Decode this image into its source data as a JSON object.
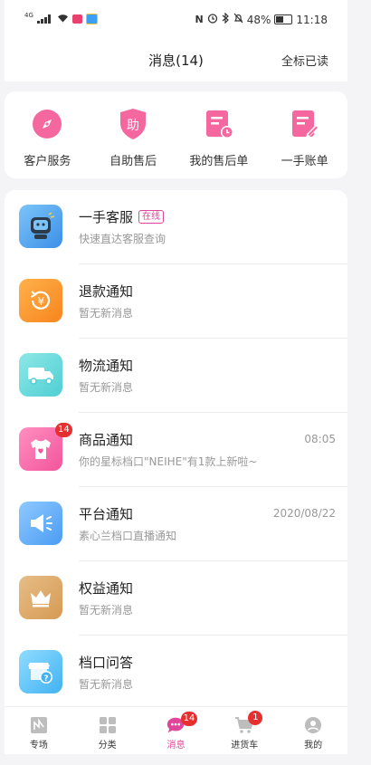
{
  "status_bar": {
    "signal": "4G",
    "battery": "48%",
    "time": "11:18"
  },
  "header": {
    "title": "消息(14)",
    "mark_all_read": "全标已读"
  },
  "quick_entries": [
    {
      "label": "客户服务",
      "icon": "compass-icon"
    },
    {
      "label": "自助售后",
      "icon": "self-service-icon",
      "glyph": "助"
    },
    {
      "label": "我的售后单",
      "icon": "after-sales-order-icon"
    },
    {
      "label": "一手账单",
      "icon": "bill-icon"
    }
  ],
  "messages": [
    {
      "title": "一手客服",
      "tag": "在线",
      "subtitle": "快速直达客服查询",
      "time": "",
      "icon": "customer-service-robot-icon"
    },
    {
      "title": "退款通知",
      "subtitle": "暂无新消息",
      "time": "",
      "icon": "refund-icon",
      "glyph": "¥"
    },
    {
      "title": "物流通知",
      "subtitle": "暂无新消息",
      "time": "",
      "icon": "truck-icon"
    },
    {
      "title": "商品通知",
      "subtitle": "你的星标档口\"NEIHE\"有1款上新啦~",
      "time": "08:05",
      "badge": "14",
      "icon": "shirt-icon"
    },
    {
      "title": "平台通知",
      "subtitle": "素心兰档口直播通知",
      "time": "2020/08/22",
      "icon": "megaphone-icon"
    },
    {
      "title": "权益通知",
      "subtitle": "暂无新消息",
      "time": "",
      "icon": "crown-icon"
    },
    {
      "title": "档口问答",
      "subtitle": "暂无新消息",
      "time": "",
      "icon": "qa-icon",
      "glyph": "?"
    }
  ],
  "tabs": [
    {
      "label": "专场",
      "icon": "special-icon"
    },
    {
      "label": "分类",
      "icon": "category-icon"
    },
    {
      "label": "消息",
      "icon": "message-icon",
      "badge": "14"
    },
    {
      "label": "进货车",
      "icon": "cart-icon",
      "badge": "1"
    },
    {
      "label": "我的",
      "icon": "profile-icon"
    }
  ],
  "colors": {
    "accent": "#e0459a",
    "badge": "#e63030"
  }
}
